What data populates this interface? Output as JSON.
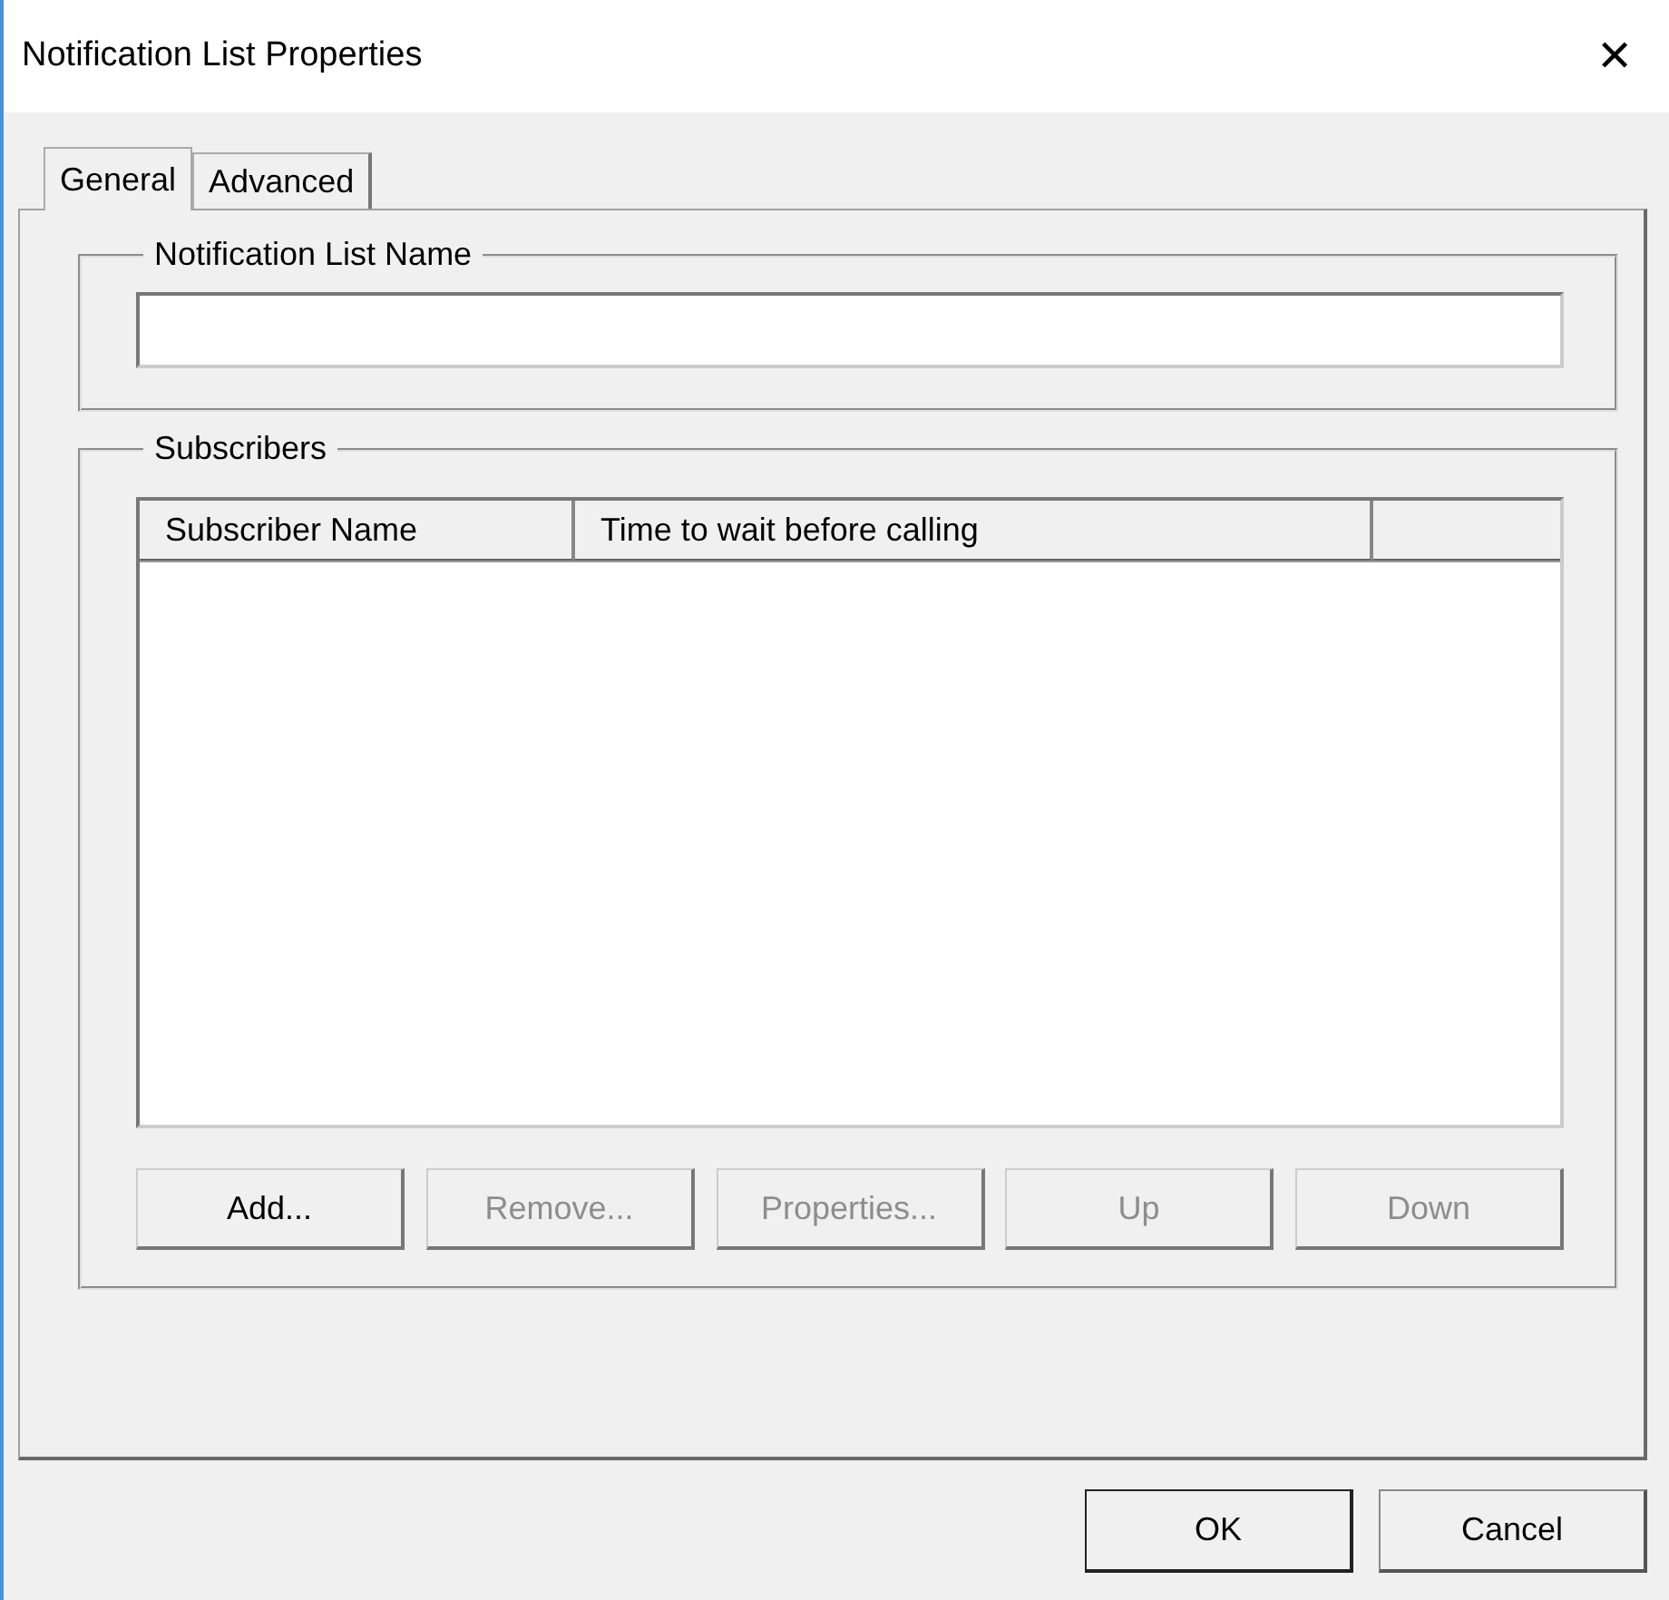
{
  "window": {
    "title": "Notification List Properties",
    "close": "✕"
  },
  "tabs": [
    {
      "label": "General",
      "selected": true
    },
    {
      "label": "Advanced",
      "selected": false
    }
  ],
  "name_group": {
    "title": "Notification List Name"
  },
  "subscribers_group": {
    "title": "Subscribers",
    "table": {
      "columns": [
        "Subscriber Name",
        "Time to wait before calling"
      ]
    },
    "buttons": [
      {
        "label": "Add...",
        "disabled": false
      },
      {
        "label": "Remove...",
        "disabled": true
      },
      {
        "label": "Properties...",
        "disabled": true
      },
      {
        "label": "Up",
        "disabled": true
      },
      {
        "label": "Down",
        "disabled": true
      }
    ]
  },
  "buttons": [
    {
      "label": "OK",
      "default": true
    },
    {
      "label": "Cancel",
      "default": false
    }
  ]
}
